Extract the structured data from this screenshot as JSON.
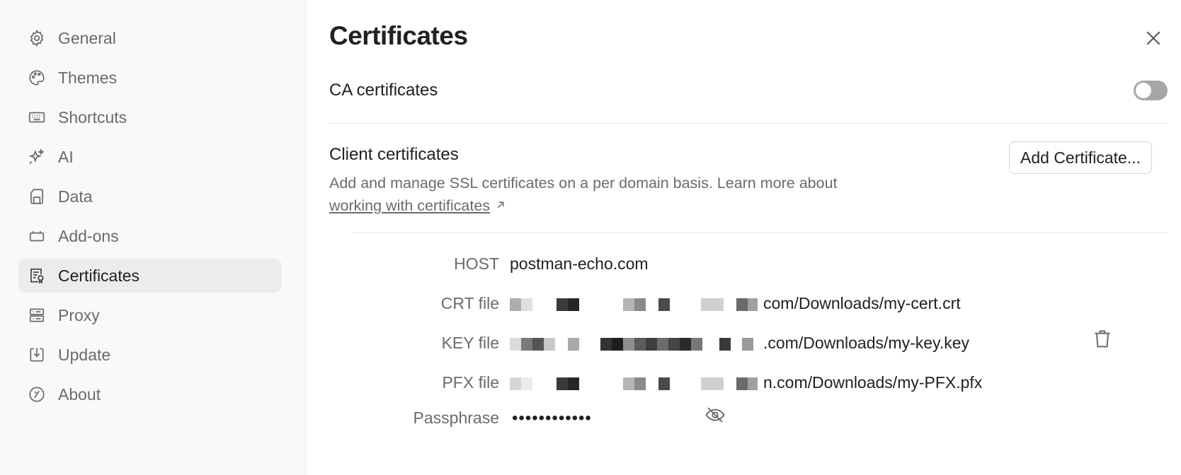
{
  "sidebar": {
    "items": [
      {
        "label": "General",
        "icon": "gear-icon"
      },
      {
        "label": "Themes",
        "icon": "palette-icon"
      },
      {
        "label": "Shortcuts",
        "icon": "keyboard-icon"
      },
      {
        "label": "AI",
        "icon": "sparkle-icon"
      },
      {
        "label": "Data",
        "icon": "sd-card-icon"
      },
      {
        "label": "Add-ons",
        "icon": "plugin-icon"
      },
      {
        "label": "Certificates",
        "icon": "certificate-icon"
      },
      {
        "label": "Proxy",
        "icon": "server-icon"
      },
      {
        "label": "Update",
        "icon": "download-icon"
      },
      {
        "label": "About",
        "icon": "info-badge-icon"
      }
    ],
    "active": "Certificates"
  },
  "main": {
    "title": "Certificates",
    "ca": {
      "label": "CA certificates",
      "enabled": false
    },
    "client": {
      "label": "Client certificates",
      "description": "Add and manage SSL certificates on a per domain basis. Learn more about",
      "link_text": "working with certificates",
      "add_button": "Add Certificate..."
    },
    "certificate": {
      "host_label": "HOST",
      "host_value": "postman-echo.com",
      "crt_label": "CRT file",
      "crt_value": "com/Downloads/my-cert.crt",
      "key_label": "KEY file",
      "key_value": ".com/Downloads/my-key.key",
      "pfx_label": "PFX file",
      "pfx_value": "n.com/Downloads/my-PFX.pfx",
      "passphrase_label": "Passphrase",
      "passphrase_value": "••••••••••••"
    }
  },
  "colors": {
    "sidebar_bg": "#f9f9f9",
    "active_item_bg": "#ececec",
    "toggle_off": "#a6a6a6",
    "muted_text": "#6b6b6b"
  }
}
